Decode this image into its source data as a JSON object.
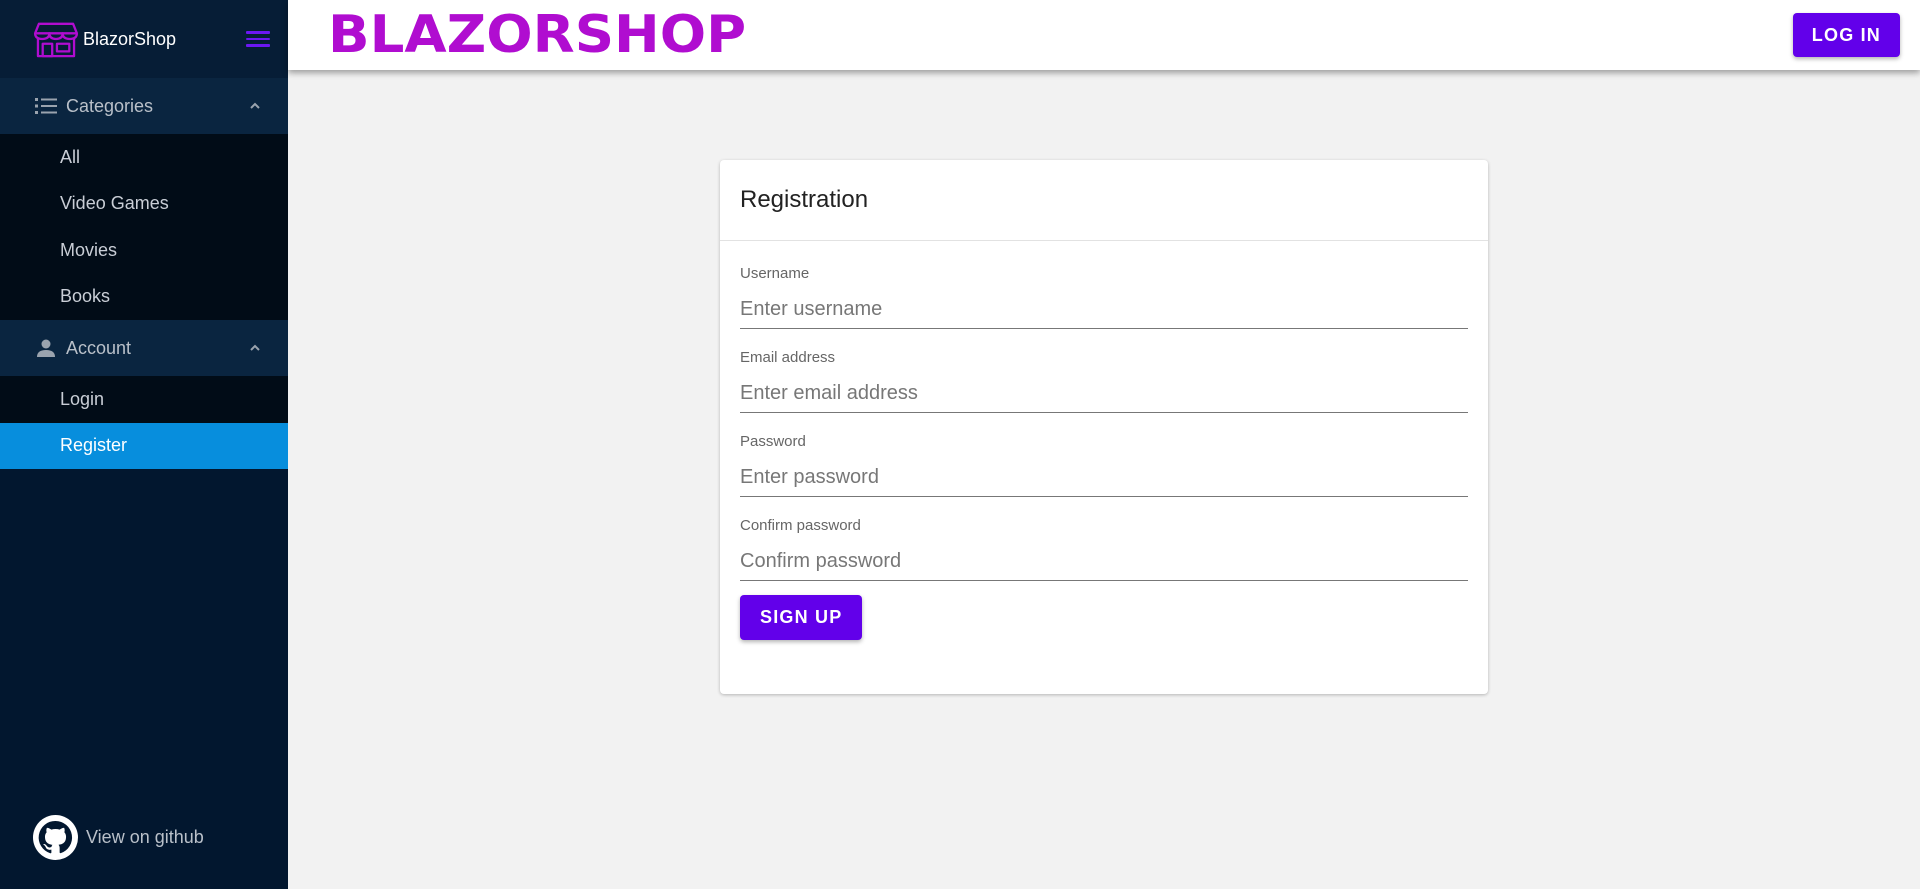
{
  "brand": {
    "name": "BlazorShop",
    "logo_icon": "shop-storefront-icon",
    "accent": "#b00dd0"
  },
  "header": {
    "logo_text": "BLAZORSHOP",
    "login_label": "LOG IN"
  },
  "sidebar": {
    "groups": [
      {
        "label": "Categories",
        "icon": "list-icon",
        "expanded": true,
        "items": [
          {
            "label": "All"
          },
          {
            "label": "Video Games"
          },
          {
            "label": "Movies"
          },
          {
            "label": "Books"
          }
        ]
      },
      {
        "label": "Account",
        "icon": "person-icon",
        "expanded": true,
        "items": [
          {
            "label": "Login"
          },
          {
            "label": "Register",
            "active": true
          }
        ]
      }
    ],
    "github_label": "View on github"
  },
  "form": {
    "title": "Registration",
    "fields": [
      {
        "label": "Username",
        "placeholder": "Enter username",
        "value": ""
      },
      {
        "label": "Email address",
        "placeholder": "Enter email address",
        "value": ""
      },
      {
        "label": "Password",
        "placeholder": "Enter password",
        "value": ""
      },
      {
        "label": "Confirm password",
        "placeholder": "Confirm password",
        "value": ""
      }
    ],
    "submit_label": "SIGN UP"
  },
  "colors": {
    "primary": "#6200ea",
    "sidebar_bg": "#02172f",
    "active_item": "#078edd",
    "background": "#f2f2f2"
  }
}
